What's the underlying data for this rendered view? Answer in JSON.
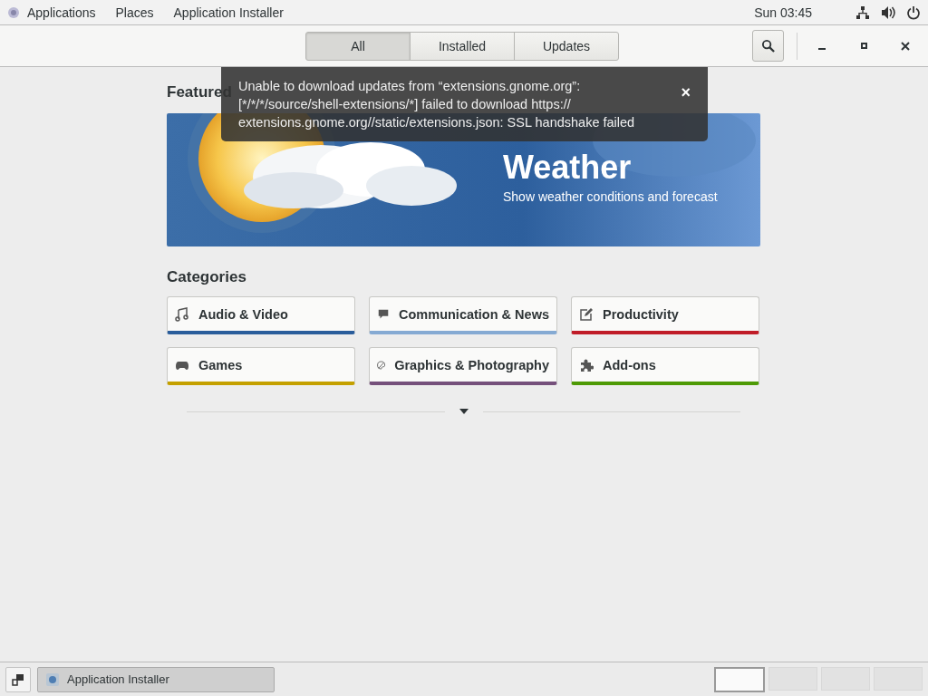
{
  "top_bar": {
    "activities": "Applications",
    "places": "Places",
    "app_menu": "Application Installer",
    "clock": "Sun 03:45"
  },
  "header": {
    "tabs": [
      {
        "label": "All",
        "selected": true
      },
      {
        "label": "Installed",
        "selected": false
      },
      {
        "label": "Updates",
        "selected": false
      }
    ]
  },
  "notification": {
    "message": "Unable to download updates from “extensions.gnome.org”: [*/*/*/source/shell-extensions/*] failed to download https:// extensions.gnome.org//static/extensions.json: SSL handshake failed",
    "close": "×"
  },
  "featured": {
    "heading": "Featured",
    "title": "Weather",
    "subtitle": "Show weather conditions and forecast"
  },
  "categories": {
    "heading": "Categories",
    "items": [
      {
        "label": "Audio & Video",
        "color": "#2a5d9b"
      },
      {
        "label": "Communication & News",
        "color": "#85aad3"
      },
      {
        "label": "Productivity",
        "color": "#c01c28"
      },
      {
        "label": "Games",
        "color": "#c4a000"
      },
      {
        "label": "Graphics & Photography",
        "color": "#75507b"
      },
      {
        "label": "Add-ons",
        "color": "#4e9a06"
      }
    ]
  },
  "taskbar": {
    "window": "Application Installer",
    "workspaces": [
      {
        "selected": true
      },
      {
        "selected": false
      },
      {
        "selected": false
      },
      {
        "selected": false
      }
    ]
  }
}
